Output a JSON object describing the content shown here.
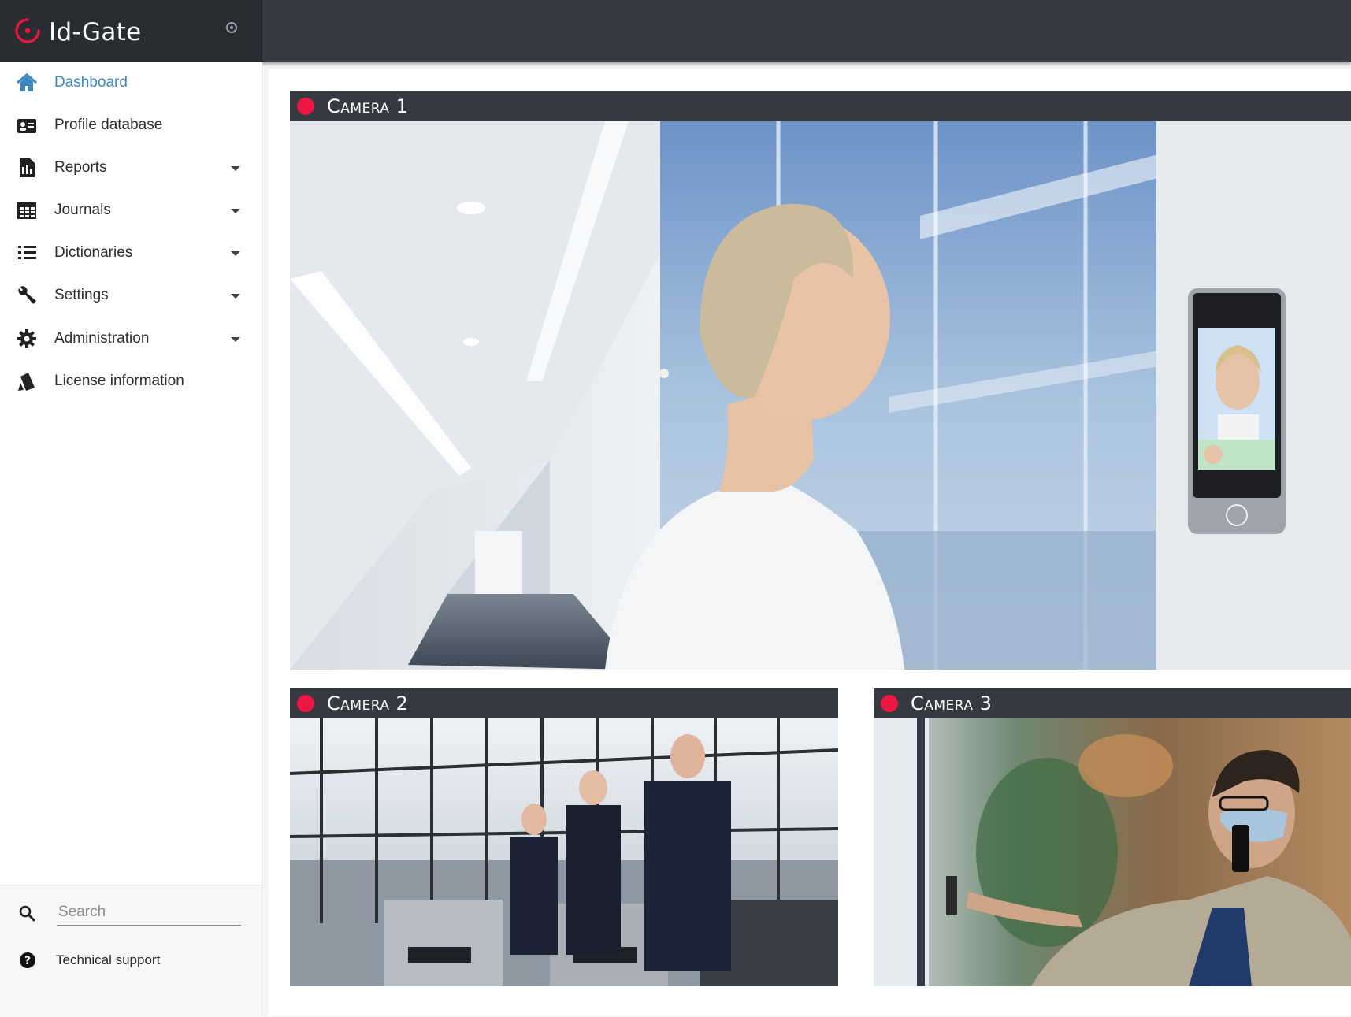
{
  "app": {
    "name": "Id-Gate",
    "logo_icon": "id-gate-logo-icon",
    "pin_icon": "radio-toggle-icon",
    "accent_color": "#3b87c4",
    "header_color": "#353a40",
    "record_color": "#ee1743"
  },
  "sidebar": {
    "items": [
      {
        "label": "Dashboard",
        "icon": "home-icon",
        "active": true
      },
      {
        "label": "Profile database",
        "icon": "id-card-icon"
      },
      {
        "label": "Reports",
        "icon": "report-icon",
        "expandable": true
      },
      {
        "label": "Journals",
        "icon": "table-icon",
        "expandable": true
      },
      {
        "label": "Dictionaries",
        "icon": "list-icon",
        "expandable": true
      },
      {
        "label": "Settings",
        "icon": "wrench-icon",
        "expandable": true
      },
      {
        "label": "Administration",
        "icon": "gear-icon",
        "expandable": true
      },
      {
        "label": "License information",
        "icon": "license-icon"
      }
    ],
    "search": {
      "placeholder": "Search",
      "value": "",
      "icon": "search-icon"
    },
    "support": {
      "label": "Technical support",
      "icon": "question-icon"
    }
  },
  "cameras": [
    {
      "title": "Camera 1",
      "status": "recording"
    },
    {
      "title": "Camera 2",
      "status": "recording"
    },
    {
      "title": "Camera 3",
      "status": "recording"
    }
  ]
}
